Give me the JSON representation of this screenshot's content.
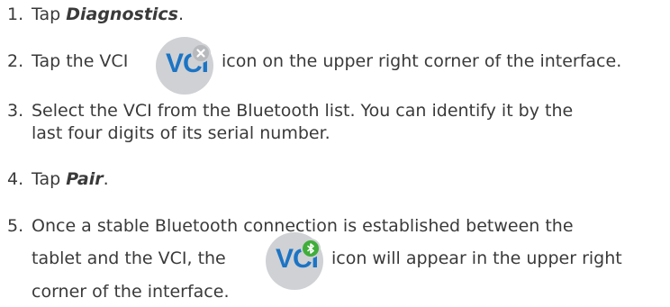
{
  "steps": [
    {
      "num": "1.",
      "prefix": "Tap ",
      "bold": "Diagnostics",
      "suffix": "."
    },
    {
      "num": "2.",
      "prefix": "Tap the VCI",
      "after_icon": "icon on the upper right corner of the interface."
    },
    {
      "num": "3.",
      "line1": "Select the VCI from the Bluetooth list. You can identify it by the",
      "line2": "last four digits of its serial number."
    },
    {
      "num": "4.",
      "prefix": "Tap ",
      "bold": "Pair",
      "suffix": "."
    },
    {
      "num": "5.",
      "line1": "Once a stable Bluetooth connection is established between the",
      "line2_prefix": "tablet and the VCI, the",
      "line2_suffix": "icon will appear in the upper right",
      "line3": "corner of the interface."
    }
  ],
  "icons": {
    "vci_text": "VCI",
    "disconnected_badge": "close-icon",
    "connected_badge": "bluetooth-icon",
    "text_color": "#1c74c4",
    "disconnected_color": "#b7b9bc",
    "connected_color": "#3fae3a"
  }
}
